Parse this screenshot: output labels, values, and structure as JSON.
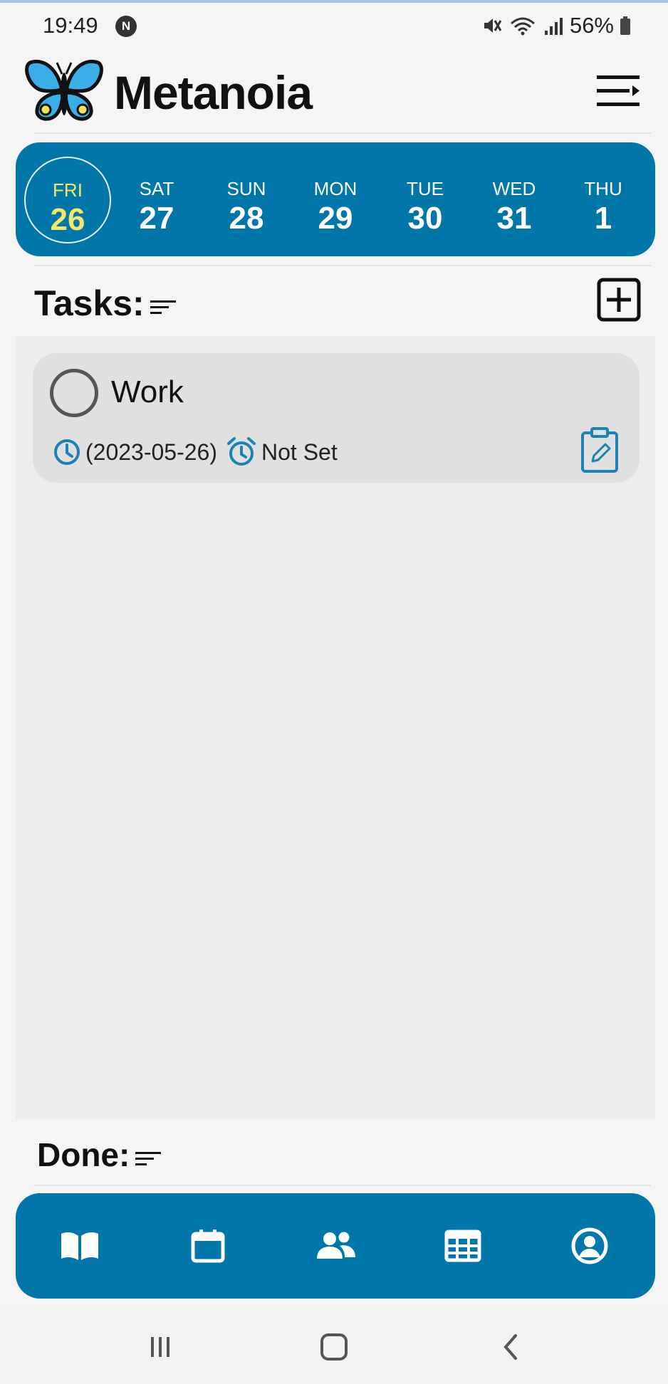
{
  "status_bar": {
    "time": "19:49",
    "badge": "N",
    "battery": "56%"
  },
  "header": {
    "title": "Metanoia",
    "logo_icon": "butterfly-logo",
    "menu_icon": "menu-collapse-icon"
  },
  "week": {
    "days": [
      {
        "name": "FRI",
        "date": "26",
        "selected": true
      },
      {
        "name": "SAT",
        "date": "27",
        "selected": false
      },
      {
        "name": "SUN",
        "date": "28",
        "selected": false
      },
      {
        "name": "MON",
        "date": "29",
        "selected": false
      },
      {
        "name": "TUE",
        "date": "30",
        "selected": false
      },
      {
        "name": "WED",
        "date": "31",
        "selected": false
      },
      {
        "name": "THU",
        "date": "1",
        "selected": false
      }
    ]
  },
  "tasks_section": {
    "label": "Tasks:",
    "sort_icon": "sort-icon",
    "add_icon": "add-box-icon",
    "items": [
      {
        "title": "Work",
        "date": "(2023-05-26)",
        "alarm": "Not Set",
        "date_icon": "clock-icon",
        "alarm_icon": "alarm-clock-icon",
        "edit_icon": "clipboard-edit-icon"
      }
    ]
  },
  "done_section": {
    "label": "Done:"
  },
  "bottom_nav": {
    "items": [
      {
        "icon": "book-icon"
      },
      {
        "icon": "calendar-icon"
      },
      {
        "icon": "people-icon"
      },
      {
        "icon": "grid-table-icon"
      },
      {
        "icon": "account-circle-icon"
      }
    ]
  },
  "system_nav": [
    "recents-icon",
    "home-icon",
    "back-icon"
  ],
  "colors": {
    "accent": "#0077a8",
    "selected_day": "#f3e86a",
    "background": "#f5f5f5",
    "panel": "#eeeeee",
    "card": "#e0e0e0",
    "icon_blue": "#1a83b6"
  }
}
